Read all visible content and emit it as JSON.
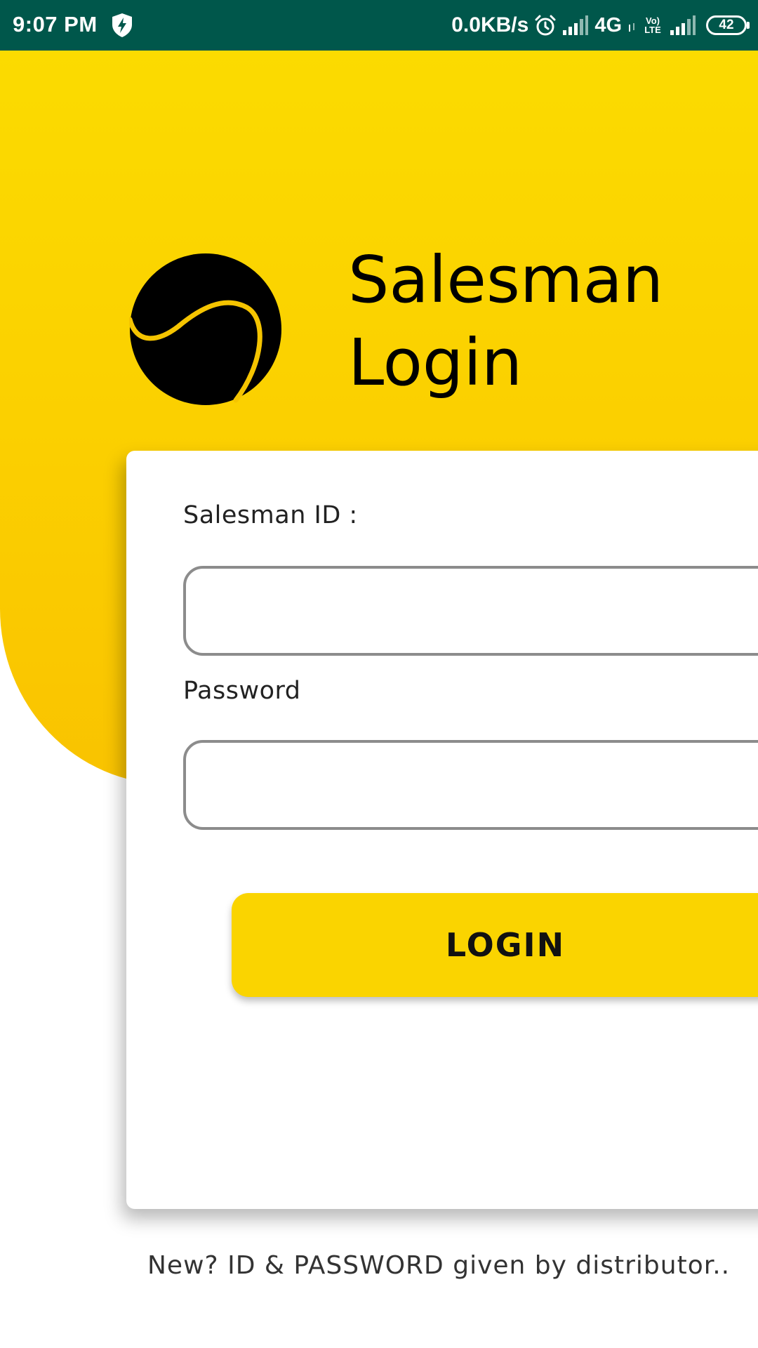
{
  "status_bar": {
    "time": "9:07 PM",
    "net_speed": "0.0KB/s",
    "network_type": "4G",
    "volte": "Vo) LTE",
    "battery_level": "42",
    "icons": [
      "shield-icon",
      "alarm-icon",
      "signal-icon",
      "volte-icon",
      "battery-icon"
    ]
  },
  "header": {
    "title_line1": "Salesman",
    "title_line2": "Login",
    "logo": "brand-logo"
  },
  "form": {
    "salesman_id_label": "Salesman ID :",
    "salesman_id_value": "",
    "password_label": "Password",
    "password_value": "",
    "login_button": "LOGIN"
  },
  "footer": {
    "note": "New? ID & PASSWORD given by distributor.."
  },
  "colors": {
    "status_bar": "#00574b",
    "accent_yellow": "#fad400",
    "input_border": "#8c8c8c"
  }
}
